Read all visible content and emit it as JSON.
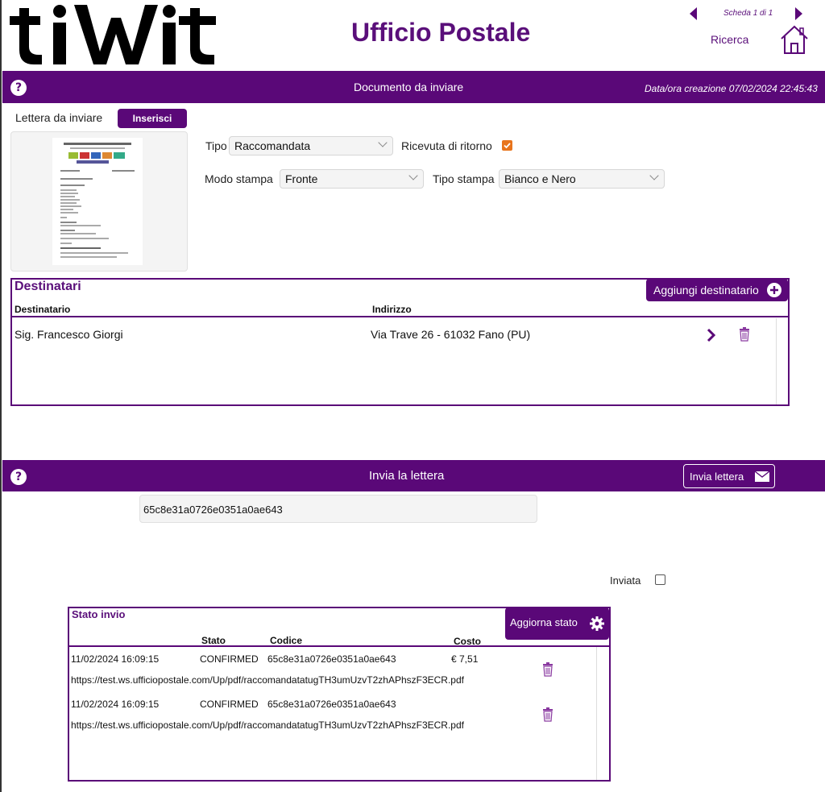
{
  "header": {
    "logo_text": "tiWit",
    "title": "Ufficio Postale",
    "scheda": "Scheda 1 di 1",
    "ricerca": "Ricerca"
  },
  "doc_bar": {
    "title": "Documento da inviare",
    "date": "Data/ora creazione 07/02/2024 22:45:43"
  },
  "lettera": {
    "label": "Lettera da inviare",
    "insert_btn": "Inserisci"
  },
  "form": {
    "tipo_label": "Tipo",
    "tipo_value": "Raccomandata",
    "ricevuta_label": "Ricevuta di ritorno",
    "ricevuta_checked": true,
    "modo_label": "Modo stampa",
    "modo_value": "Fronte",
    "tipo_stampa_label": "Tipo stampa",
    "tipo_stampa_value": "Bianco e Nero"
  },
  "destinatari": {
    "title": "Destinatari",
    "add_btn": "Aggiungi destinatario",
    "col_dest": "Destinatario",
    "col_addr": "Indirizzo",
    "rows": [
      {
        "name": "Sig. Francesco Giorgi",
        "address": "Via Trave 26 - 61032 Fano (PU)"
      }
    ]
  },
  "invia_bar": {
    "title": "Invia la lettera",
    "btn": "Invia lettera"
  },
  "codice_field": "65c8e31a0726e0351a0ae643",
  "inviata_label": "Inviata",
  "stato": {
    "title": "Stato invio",
    "refresh_btn": "Aggiorna stato",
    "col_stato": "Stato",
    "col_codice": "Codice",
    "col_costo": "Costo",
    "rows": [
      {
        "date": "11/02/2024 16:09:15",
        "stato": "CONFIRMED",
        "codice": "65c8e31a0726e0351a0ae643",
        "costo": "€ 7,51",
        "url": "https://test.ws.ufficiopostale.com/Up/pdf/raccomandatatugTH3umUzvT2zhAPhszF3ECR.pdf"
      },
      {
        "date": "11/02/2024 16:09:15",
        "stato": "CONFIRMED",
        "codice": "65c8e31a0726e0351a0ae643",
        "costo": "",
        "url": "https://test.ws.ufficiopostale.com/Up/pdf/raccomandatatugTH3umUzvT2zhAPhszF3ECR.pdf"
      }
    ]
  },
  "colors": {
    "accent": "#5a0878",
    "checkbox": "#e8741c"
  }
}
